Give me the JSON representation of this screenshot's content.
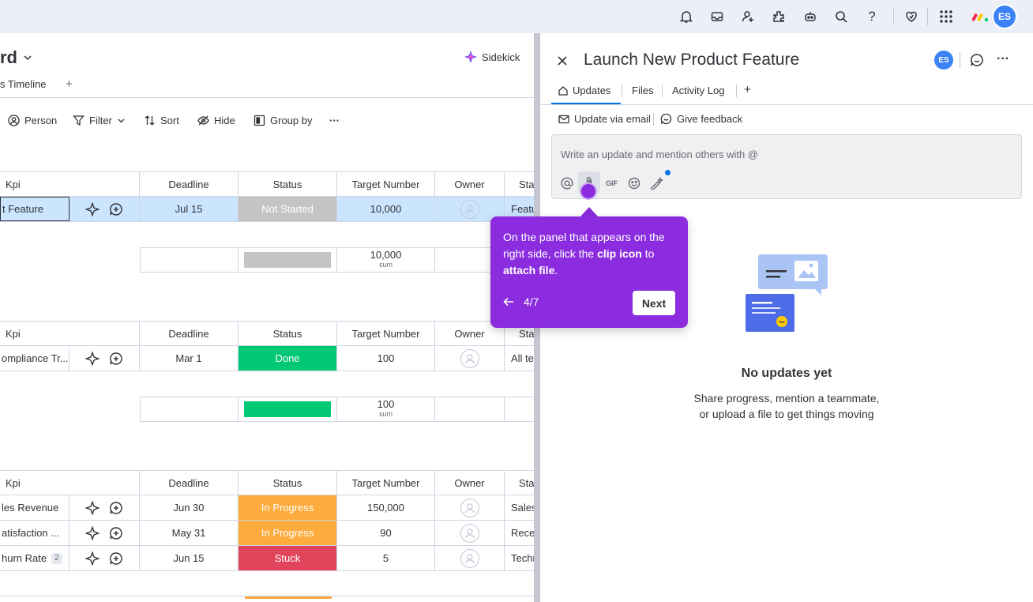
{
  "topbar": {
    "avatar_initials": "ES",
    "icons": [
      "bell-icon",
      "inbox-icon",
      "invite-icon",
      "apps-icon",
      "robot-icon",
      "search-icon",
      "help-icon",
      "heart-icon",
      "grid-icon",
      "monday-logo-icon"
    ]
  },
  "board": {
    "title": "rd",
    "sidekick_label": "Sidekick",
    "view_tab": "s Timeline",
    "view_add": "+",
    "toolbar": {
      "person": "Person",
      "filter": "Filter",
      "sort": "Sort",
      "hide": "Hide",
      "group_by": "Group by",
      "more": "···"
    },
    "columns": {
      "kpi": "Kpi",
      "deadline": "Deadline",
      "status": "Status",
      "target": "Target Number",
      "owner": "Owner",
      "sta": "Sta"
    },
    "groups": [
      {
        "rows": [
          {
            "name": "t Feature",
            "deadline": "Jul 15",
            "status": "Not Started",
            "target": "10,000",
            "extra": "Featu"
          }
        ],
        "sum": "10,000",
        "sum_label": "sum"
      },
      {
        "rows": [
          {
            "name": "ompliance Tr...",
            "deadline": "Mar 1",
            "status": "Done",
            "target": "100",
            "extra": "All te"
          }
        ],
        "sum": "100",
        "sum_label": "sum"
      },
      {
        "rows": [
          {
            "name": "les Revenue",
            "deadline": "Jun 30",
            "status": "In Progress",
            "target": "150,000",
            "extra": "Sales"
          },
          {
            "name": "atisfaction ...",
            "deadline": "May 31",
            "status": "In Progress",
            "target": "90",
            "extra": "Rece"
          },
          {
            "name": "hurn Rate",
            "badge": "2",
            "deadline": "Jun 15",
            "status": "Stuck",
            "target": "5",
            "extra": "Techn"
          }
        ]
      }
    ],
    "status_colors": {
      "Not Started": "#c4c4c4",
      "Done": "#00c875",
      "In Progress": "#fdab3d",
      "Stuck": "#e2445c"
    }
  },
  "panel": {
    "title": "Launch New Product Feature",
    "avatar_initials": "ES",
    "tabs": {
      "updates": "Updates",
      "files": "Files",
      "activity": "Activity Log",
      "add": "+"
    },
    "update_via_email": "Update via email",
    "give_feedback": "Give feedback",
    "editor_placeholder": "Write an update and mention others with @",
    "editor_gif": "GIF",
    "empty_title": "No updates yet",
    "empty_line1": "Share progress, mention a teammate,",
    "empty_line2": "or upload a file to get things moving"
  },
  "tooltip": {
    "text_1": "On the panel that appears on the right side, click the ",
    "bold_1": "clip icon",
    "text_2": " to ",
    "bold_2": "attach file",
    "text_3": ".",
    "step": "4/7",
    "next": "Next",
    "color": "#8b2cde"
  }
}
